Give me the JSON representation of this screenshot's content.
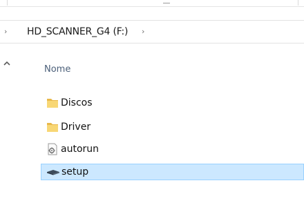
{
  "breadcrumb": {
    "location_label": "HD_SCANNER_G4 (F:)",
    "chevron_glyph": "›"
  },
  "file_list": {
    "name_column_header": "Nome",
    "items": [
      {
        "label": "Discos",
        "icon": "folder-icon",
        "selected": false
      },
      {
        "label": "Driver",
        "icon": "folder-icon",
        "selected": false
      },
      {
        "label": "autorun",
        "icon": "settings-file-icon",
        "selected": false
      },
      {
        "label": "setup",
        "icon": "installer-icon",
        "selected": true
      }
    ]
  },
  "colors": {
    "selection_background": "#cce8ff",
    "selection_border": "#99d1ff",
    "header_text": "#4c607a",
    "folder_yellow": "#f8d775"
  }
}
